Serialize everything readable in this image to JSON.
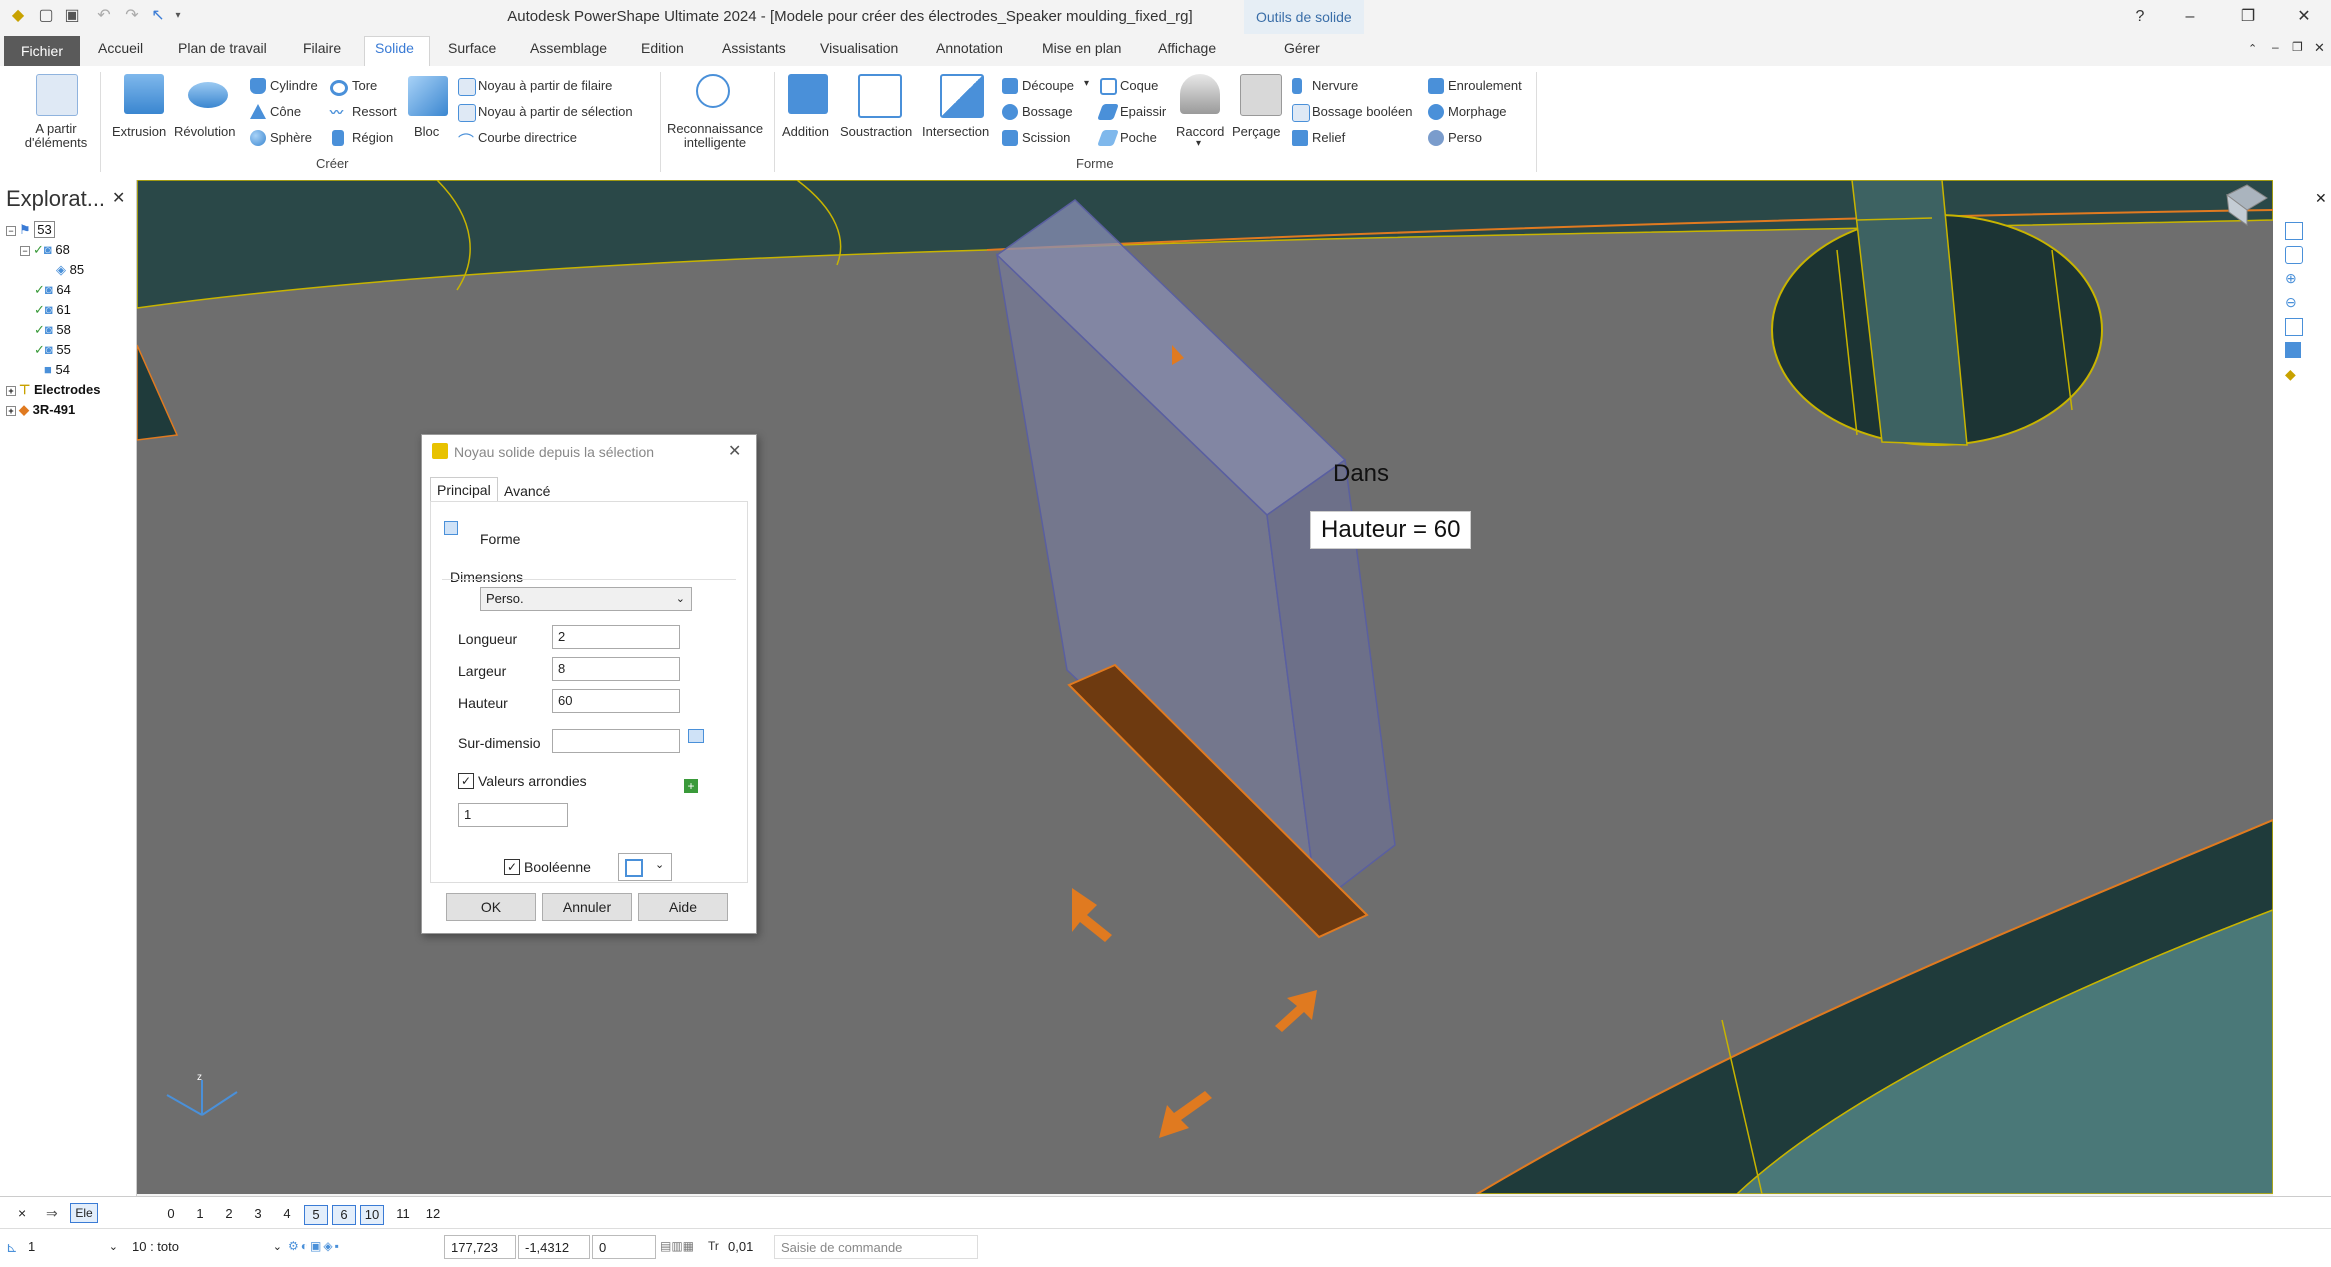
{
  "window": {
    "title": "Autodesk PowerShape Ultimate 2024 - [Modele pour créer des électrodes_Speaker moulding_fixed_rg]",
    "context_tab": "Outils de solide"
  },
  "tabs": {
    "file": "Fichier",
    "items": [
      "Accueil",
      "Plan de travail",
      "Filaire",
      "Solide",
      "Surface",
      "Assemblage",
      "Edition",
      "Assistants",
      "Visualisation",
      "Annotation",
      "Mise en plan",
      "Affichage",
      "Gérer"
    ],
    "active": "Solide"
  },
  "ribbon": {
    "from_elements": "A partir\nd'éléments",
    "extrusion": "Extrusion",
    "revolution": "Révolution",
    "cylinder": "Cylindre",
    "cone": "Cône",
    "sphere": "Sphère",
    "torus": "Tore",
    "spring": "Ressort",
    "region": "Région",
    "block": "Bloc",
    "core_wire": "Noyau à partir de filaire",
    "core_selection": "Noyau à partir de sélection",
    "guide_curve": "Courbe directrice",
    "group_create": "Créer",
    "smart_recognition": "Reconnaissance\nintelligente",
    "addition": "Addition",
    "subtraction": "Soustraction",
    "intersection": "Intersection",
    "cut": "Découpe",
    "boss": "Bossage",
    "split": "Scission",
    "shell": "Coque",
    "thicken": "Epaissir",
    "pocket": "Poche",
    "fillet": "Raccord",
    "drill": "Perçage",
    "rib": "Nervure",
    "boolean_boss": "Bossage booléen",
    "relief": "Relief",
    "wrap": "Enroulement",
    "morph": "Morphage",
    "custom": "Perso",
    "group_shape": "Forme"
  },
  "explorer": {
    "title": "Explorat...",
    "nodes": [
      {
        "label": "53"
      },
      {
        "label": "68"
      },
      {
        "label": "85"
      },
      {
        "label": "64"
      },
      {
        "label": "61"
      },
      {
        "label": "58"
      },
      {
        "label": "55"
      },
      {
        "label": "54"
      },
      {
        "label": "Electrodes"
      },
      {
        "label": "3R-491"
      }
    ]
  },
  "viewport": {
    "in_label": "Dans",
    "height_tip": "Hauteur = 60"
  },
  "dialog": {
    "title": "Noyau solide depuis la sélection",
    "tab_main": "Principal",
    "tab_advanced": "Avancé",
    "shape_label": "Forme",
    "dimensions_label": "Dimensions",
    "dimensions_select": "Perso.",
    "length_label": "Longueur",
    "length_value": "2",
    "width_label": "Largeur",
    "width_value": "8",
    "height_label": "Hauteur",
    "height_value": "60",
    "oversize_label": "Sur-dimensio",
    "oversize_value": "",
    "rounded_label": "Valeurs arrondies",
    "rounded_checked": true,
    "rounded_value": "1",
    "boolean_label": "Booléenne",
    "boolean_checked": true,
    "ok": "OK",
    "cancel": "Annuler",
    "help": "Aide"
  },
  "statusbar": {
    "close_x": "×",
    "ele": "Ele",
    "levels": [
      "0",
      "1",
      "2",
      "3",
      "4",
      "5",
      "6",
      "10",
      "11",
      "12"
    ],
    "selected_levels": [
      "5",
      "6",
      "10"
    ],
    "workplane": "1",
    "level_name": "10 : toto",
    "x": "177,723",
    "y": "-1,4312",
    "z": "0",
    "tr_label": "Tr",
    "tolerance": "0,01",
    "command_placeholder": "Saisie de commande"
  },
  "colors": {
    "accent": "#3a7bd5",
    "viewport_gray": "#6e6e6e",
    "teal_dark": "#1f3b3b",
    "orange": "#e07a20",
    "icon_blue": "#4a90d9"
  }
}
